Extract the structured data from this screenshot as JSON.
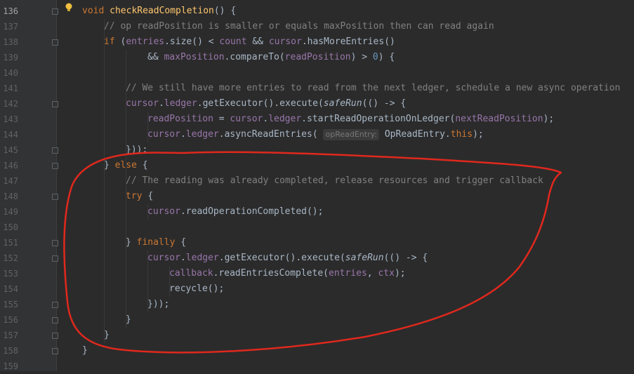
{
  "editor": {
    "active_line": "136",
    "annotation_color": "#e0281d",
    "lines": [
      {
        "num": "136",
        "indent": 0,
        "html": "<span class='kw'>void </span><span class='fn'>checkReadCompletion</span>() {"
      },
      {
        "num": "137",
        "indent": 1,
        "html": "<span class='cmt'>// op readPosition is smaller or equals maxPosition then can read again</span>"
      },
      {
        "num": "138",
        "indent": 1,
        "html": "<span class='kw'>if </span>(<span class='fld'>entries</span>.size() &lt; <span class='fld'>count</span> &amp;&amp; <span class='fld'>cursor</span>.hasMoreEntries()"
      },
      {
        "num": "139",
        "indent": 3,
        "html": "&amp;&amp; <span class='fld'>maxPosition</span>.compareTo(<span class='fld'>readPosition</span>) &gt; <span class='num'>0</span>) {"
      },
      {
        "num": "140",
        "indent": 0,
        "html": ""
      },
      {
        "num": "141",
        "indent": 2,
        "html": "<span class='cmt'>// We still have more entries to read from the next ledger, schedule a new async operation</span>"
      },
      {
        "num": "142",
        "indent": 2,
        "html": "<span class='fld'>cursor</span>.<span class='fld'>ledger</span>.getExecutor().execute(<span class='it'>safeRun</span>(() -&gt; {"
      },
      {
        "num": "143",
        "indent": 3,
        "html": "<span class='fld'>readPosition</span> = <span class='fld'>cursor</span>.<span class='fld'>ledger</span>.startReadOperationOnLedger(<span class='fld'>nextReadPosition</span>);"
      },
      {
        "num": "144",
        "indent": 3,
        "html": "<span class='fld'>cursor</span>.<span class='fld'>ledger</span>.asyncReadEntries( <span class='hint'>opReadEntry:</span> OpReadEntry.<span class='kw'>this</span>);"
      },
      {
        "num": "145",
        "indent": 2,
        "html": "}));"
      },
      {
        "num": "146",
        "indent": 1,
        "html": "} <span class='kw'>else </span>{"
      },
      {
        "num": "147",
        "indent": 2,
        "html": "<span class='cmt'>// The reading was already completed, release resources and trigger callback</span>"
      },
      {
        "num": "148",
        "indent": 2,
        "html": "<span class='kw'>try </span>{"
      },
      {
        "num": "149",
        "indent": 3,
        "html": "<span class='fld'>cursor</span>.readOperationCompleted();"
      },
      {
        "num": "150",
        "indent": 0,
        "html": ""
      },
      {
        "num": "151",
        "indent": 2,
        "html": "} <span class='kw'>finally </span>{"
      },
      {
        "num": "152",
        "indent": 3,
        "html": "<span class='fld'>cursor</span>.<span class='fld'>ledger</span>.getExecutor().execute(<span class='it'>safeRun</span>(() -&gt; {"
      },
      {
        "num": "153",
        "indent": 4,
        "html": "<span class='fld'>callback</span>.readEntriesComplete(<span class='fld'>entries</span>, <span class='fld'>ctx</span>);"
      },
      {
        "num": "154",
        "indent": 4,
        "html": "recycle();"
      },
      {
        "num": "155",
        "indent": 3,
        "html": "}));"
      },
      {
        "num": "156",
        "indent": 2,
        "html": "}"
      },
      {
        "num": "157",
        "indent": 1,
        "html": "}"
      },
      {
        "num": "158",
        "indent": 0,
        "html": "}"
      },
      {
        "num": "159",
        "indent": 0,
        "html": ""
      }
    ]
  }
}
